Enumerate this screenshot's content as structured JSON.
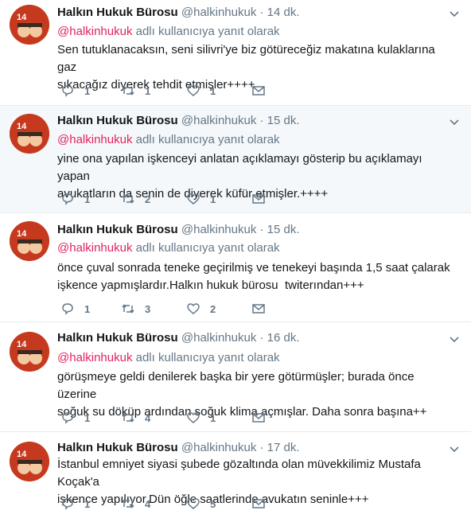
{
  "tweets": [
    {
      "name": "Halkın Hukuk Bürosu",
      "handle": "@halkinhukuk",
      "dot": "·",
      "time": "14 dk.",
      "reply_handle": "@halkinhukuk",
      "reply_text": "adlı kullanıcıya yanıt olarak",
      "text": "Sen tutuklanacaksın, seni silivri'ye biz götüreceğiz makatına kulaklarına gaz\nsıkacağız diyerek tehdit etmişler++++",
      "replies": "1",
      "retweets": "1",
      "likes": "1"
    },
    {
      "name": "Halkın Hukuk Bürosu",
      "handle": "@halkinhukuk",
      "dot": "·",
      "time": "15 dk.",
      "reply_handle": "@halkinhukuk",
      "reply_text": "adlı kullanıcıya yanıt olarak",
      "text": "yine ona yapılan işkenceyi anlatan açıklamayı gösterip bu açıklamayı yapan\navukatların da senin de diyerek küfür etmişler.++++",
      "replies": "1",
      "retweets": "2",
      "likes": "1"
    },
    {
      "name": "Halkın Hukuk Bürosu",
      "handle": "@halkinhukuk",
      "dot": "·",
      "time": "15 dk.",
      "reply_handle": "@halkinhukuk",
      "reply_text": "adlı kullanıcıya yanıt olarak",
      "text": "önce çuval sonrada teneke geçirilmiş ve tenekeyi başında 1,5 saat çalarak\nişkence yapmışlardır.Halkın hukuk bürosu  twiterından+++",
      "replies": "1",
      "retweets": "3",
      "likes": "2"
    },
    {
      "name": "Halkın Hukuk Bürosu",
      "handle": "@halkinhukuk",
      "dot": "·",
      "time": "16 dk.",
      "reply_handle": "@halkinhukuk",
      "reply_text": "adlı kullanıcıya yanıt olarak",
      "text": "görüşmeye geldi denilerek başka bir yere götürmüşler; burada önce üzerine\nsoğuk su döküp ardından soğuk klima açmışlar. Daha sonra başına++",
      "replies": "1",
      "retweets": "4",
      "likes": "1"
    },
    {
      "name": "Halkın Hukuk Bürosu",
      "handle": "@halkinhukuk",
      "dot": "·",
      "time": "17 dk.",
      "text": "İstanbul emniyet siyasi şubede gözaltında olan müvekkilimiz Mustafa Koçak'a\nişkence yapılıyor.Dün öğle saatlerinde avukatın seninle+++",
      "replies": "1",
      "retweets": "4",
      "likes": "5"
    }
  ],
  "avatar_logo_text": "14 EYLÜL",
  "colors": {
    "reply_handle": "#e0245e",
    "muted": "#657786",
    "highlight_bg": "#f5f8fa",
    "avatar_bg": "#c53a1f"
  },
  "icons": [
    "reply-icon",
    "retweet-icon",
    "like-icon",
    "direct-message-icon",
    "chevron-down-icon"
  ]
}
